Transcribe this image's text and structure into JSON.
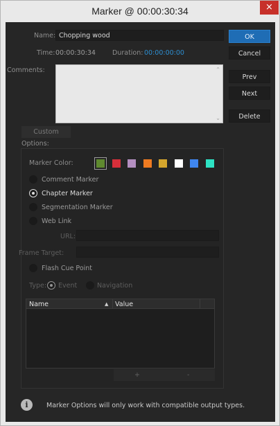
{
  "window": {
    "title": "Marker @ 00:00:30:34",
    "close_glyph": "×"
  },
  "form": {
    "name_label": "Name:",
    "name_value": "Chopping wood",
    "time_label": "Time:",
    "time_value": "00:00:30:34",
    "duration_label": "Duration:",
    "duration_value": "00:00:00:00",
    "comments_label": "Comments:",
    "comments_value": ""
  },
  "buttons": {
    "ok": "OK",
    "cancel": "Cancel",
    "prev": "Prev",
    "next": "Next",
    "delete": "Delete"
  },
  "tab": {
    "custom": "Custom"
  },
  "options": {
    "label": "Options:",
    "marker_color_label": "Marker Color:",
    "colors": [
      "#5f8a2f",
      "#d62f3a",
      "#b48fc1",
      "#ef7b21",
      "#d5a62d",
      "#ffffff",
      "#3f86ef",
      "#2ee3c4"
    ],
    "selected_color_index": 0,
    "marker_types": [
      {
        "label": "Comment Marker",
        "selected": false
      },
      {
        "label": "Chapter Marker",
        "selected": true
      },
      {
        "label": "Segmentation Marker",
        "selected": false
      },
      {
        "label": "Web Link",
        "selected": false
      }
    ],
    "url_label": "URL:",
    "url_value": "",
    "frame_target_label": "Frame Target:",
    "frame_target_value": "",
    "flash_cue_label": "Flash Cue Point",
    "type_label": "Type:",
    "type_event": "Event",
    "type_navigation": "Navigation",
    "table": {
      "col_name": "Name",
      "sort_glyph": "▲",
      "col_value": "Value"
    },
    "add_glyph": "+",
    "remove_glyph": "-"
  },
  "footer": {
    "info_glyph": "i",
    "message": "Marker Options will only work with compatible output types."
  },
  "colors": {
    "accent": "#1f6db5",
    "duration": "#2d8ed1",
    "background": "#262626"
  }
}
